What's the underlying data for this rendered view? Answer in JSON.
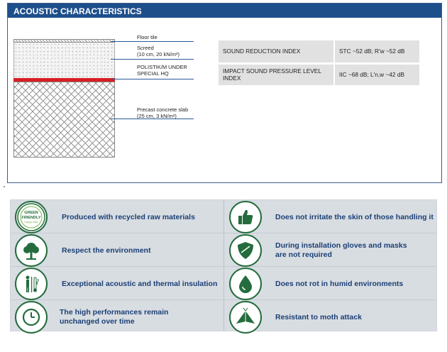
{
  "header": {
    "title": "ACOUSTIC CHARACTERISTICS"
  },
  "layers": {
    "floor_tile": "Floor tile",
    "screed_1": "Screed",
    "screed_2": "(10 cm, 20 kN/m²)",
    "mat_1": "POLISTIK/M UNDER",
    "mat_2": "SPECIAL HQ",
    "slab_1": "Precast concrete slab",
    "slab_2": "(25 cm, 3 kN/m²)"
  },
  "table": {
    "rows": [
      {
        "label": "SOUND REDUCTION INDEX",
        "value": "STC ~52 dB; R'w ~52 dB"
      },
      {
        "label": "IMPACT SOUND PRESSURE LEVEL INDEX",
        "value": "IIC ~68 dB; L'n,w ~42 dB"
      }
    ]
  },
  "badge": {
    "line1": "GREEN",
    "line2": "FRIENDLY",
    "line3": "Happy Italia"
  },
  "features": {
    "left": [
      {
        "icon": "green-friendly-badge-icon",
        "text": "Produced with recycled raw materials"
      },
      {
        "icon": "tree-icon",
        "text": "Respect the environment"
      },
      {
        "icon": "insulation-icon",
        "text": "Exceptional acoustic and thermal insulation"
      },
      {
        "icon": "clock-icon",
        "text": "The high performances remain unchanged over time"
      }
    ],
    "right": [
      {
        "icon": "thumbs-up-icon",
        "text": "Does not irritate the skin of those handling it"
      },
      {
        "icon": "shield-icon",
        "text": "During installation gloves and masks are not required"
      },
      {
        "icon": "water-drop-icon",
        "text": "Does not rot in humid environments"
      },
      {
        "icon": "moth-icon",
        "text": "Resistant to moth attack"
      }
    ]
  },
  "colors": {
    "header": "#1d4f8b",
    "feature_text": "#1b3f75",
    "icon_green": "#246c3d",
    "mat_red": "#d81e22"
  }
}
